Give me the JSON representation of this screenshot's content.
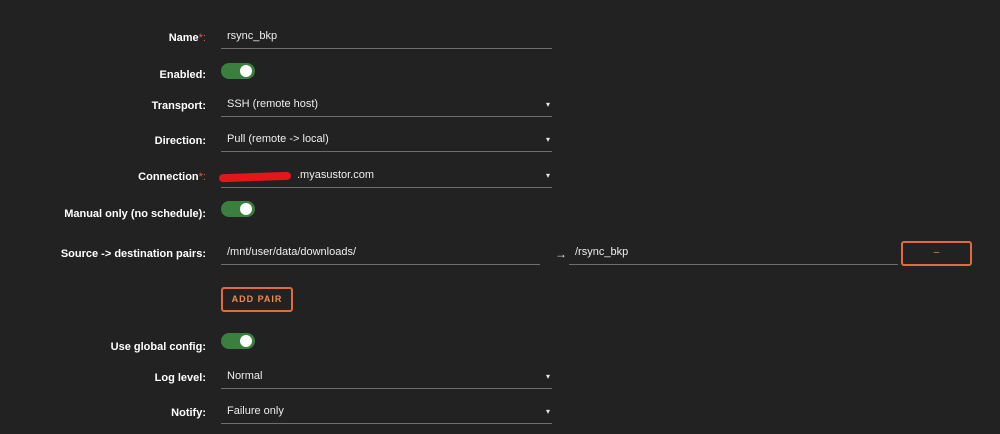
{
  "form": {
    "name": {
      "label": "Name",
      "required_mark": "*:",
      "value": "rsync_bkp"
    },
    "enabled": {
      "label": "Enabled:",
      "on": true
    },
    "transport": {
      "label": "Transport:",
      "value": "SSH (remote host)",
      "caret": "▾"
    },
    "direction": {
      "label": "Direction:",
      "value": "Pull (remote -> local)",
      "caret": "▾"
    },
    "connection": {
      "label": "Connection",
      "required_mark": "*:",
      "value": ".myasustor.com",
      "caret": "▾"
    },
    "manual_only": {
      "label": "Manual only (no schedule):",
      "on": true
    },
    "pairs": {
      "label": "Source -> destination pairs:",
      "arrow": "→",
      "items": [
        {
          "source": "/mnt/user/data/downloads/",
          "destination": "/rsync_bkp",
          "remove_label": "–"
        }
      ],
      "add_label": "ADD PAIR"
    },
    "use_global_config": {
      "label": "Use global config:",
      "on": true
    },
    "log_level": {
      "label": "Log level:",
      "value": "Normal",
      "caret": "▾"
    },
    "notify": {
      "label": "Notify:",
      "value": "Failure only",
      "caret": "▾"
    }
  },
  "colors": {
    "background": "#232222",
    "toggle_on": "#3b7f3e",
    "accent": "#e36a3d",
    "required": "#e05a4e"
  }
}
